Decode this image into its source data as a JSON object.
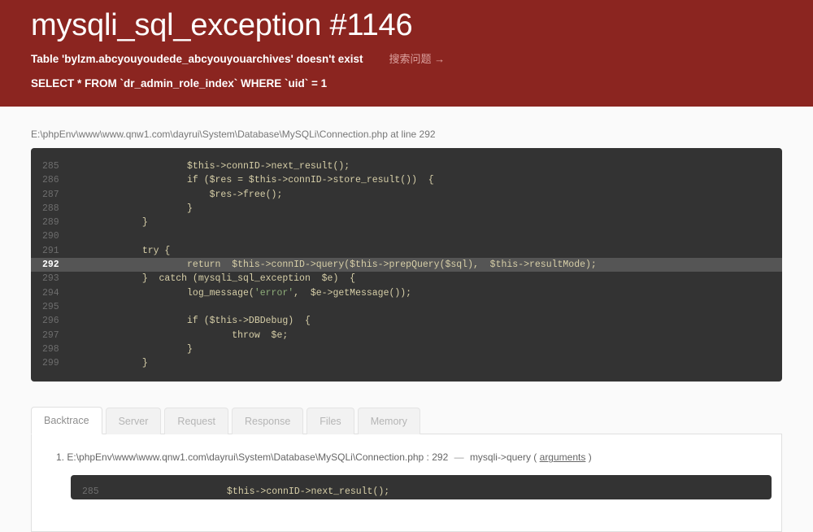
{
  "header": {
    "title": "mysqli_sql_exception #1146",
    "message": "Table 'bylzm.abcyouyoudede_abcyouyouarchives' doesn't exist",
    "search_link": "搜索问题 →",
    "query": "SELECT * FROM `dr_admin_role_index` WHERE `uid` = 1",
    "bg_color": "#8b2520"
  },
  "source": {
    "path": "E:\\phpEnv\\www\\www.qnw1.com\\dayrui\\System\\Database\\MySQLi\\Connection.php at line 292"
  },
  "code_block": {
    "highlight_line": 292,
    "lines": [
      {
        "n": "285",
        "code": "                    $this->connID->next_result();"
      },
      {
        "n": "286",
        "code": "                    if ($res = $this->connID->store_result())  {"
      },
      {
        "n": "287",
        "code": "                        $res->free();"
      },
      {
        "n": "288",
        "code": "                    }"
      },
      {
        "n": "289",
        "code": "            }"
      },
      {
        "n": "290",
        "code": ""
      },
      {
        "n": "291",
        "code": "            try {"
      },
      {
        "n": "292",
        "code": "                    return  $this->connID->query($this->prepQuery($sql),  $this->resultMode);"
      },
      {
        "n": "293",
        "code": "            }  catch (mysqli_sql_exception  $e)  {"
      },
      {
        "n": "294",
        "code": "                    log_message('error',  $e->getMessage());"
      },
      {
        "n": "295",
        "code": ""
      },
      {
        "n": "296",
        "code": "                    if ($this->DBDebug)  {"
      },
      {
        "n": "297",
        "code": "                            throw  $e;"
      },
      {
        "n": "298",
        "code": "                    }"
      },
      {
        "n": "299",
        "code": "            }"
      }
    ]
  },
  "tabs": [
    {
      "label": "Backtrace",
      "active": true
    },
    {
      "label": "Server",
      "active": false
    },
    {
      "label": "Request",
      "active": false
    },
    {
      "label": "Response",
      "active": false
    },
    {
      "label": "Files",
      "active": false
    },
    {
      "label": "Memory",
      "active": false
    }
  ],
  "backtrace": {
    "index": "1.",
    "path": "E:\\phpEnv\\www\\www.qnw1.com\\dayrui\\System\\Database\\MySQLi\\Connection.php : 292",
    "dash": "—",
    "function": "mysqli->query (",
    "arguments": "arguments",
    "close": ")",
    "code_lines": [
      {
        "n": "285",
        "code": "                    $this->connID->next_result();"
      }
    ]
  }
}
